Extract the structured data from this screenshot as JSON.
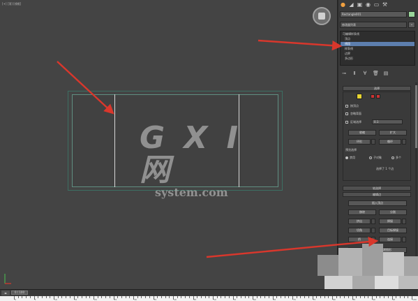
{
  "viewport": {
    "label": "[+] [顶] [线框]",
    "watermark_brand": "G X I 网",
    "watermark_domain": "system.com"
  },
  "panel": {
    "tabs": [
      "create-icon",
      "modify-icon",
      "hierarchy-icon",
      "motion-icon",
      "display-icon",
      "utilities-icon"
    ],
    "object_name": "Rectangle001",
    "object_color": "#9ad59a",
    "modifier_list": "修改器列表",
    "stack": {
      "root": "可编辑样条线",
      "items": [
        "顶点",
        "线段",
        "样条线",
        "边界",
        "多边形"
      ],
      "selected_index": 1
    },
    "selection_rollout": {
      "title": "选择",
      "by_vertex": "按顶点",
      "ignore_backfacing": "忽略背面",
      "area_selection": "区域选择",
      "area_value": "0.1",
      "shrink": "收缩",
      "grow": "扩大",
      "ring": "环形",
      "loop": "循环",
      "preview_selection": "预览选择",
      "disabled": "禁用",
      "subobject": "子对象",
      "multi": "多个",
      "selected_count": "选择了 1 个边"
    },
    "soft_selection_title": "软选择",
    "edit_edges_title": "编辑边",
    "edit_buttons": {
      "insert_vertex": "插入顶点",
      "remove": "移除",
      "split": "分割",
      "extrude": "挤出",
      "weld": "焊接",
      "chamfer": "切角",
      "target_weld": "目标焊接",
      "bridge": "桥",
      "connect": "连接",
      "create_shape": "利用所选内容创建图形"
    }
  },
  "timeline": {
    "frame_label": "0 / 100",
    "ticks": [
      "0",
      "5",
      "10",
      "15",
      "20",
      "25",
      "30",
      "35",
      "40",
      "45",
      "50",
      "55",
      "60",
      "65",
      "70",
      "75",
      "80",
      "85",
      "90",
      "95",
      "100"
    ]
  },
  "colors": {
    "selection_highlight": "#5d7fae",
    "arrow": "#d9372c",
    "active_tab": "#f0a040",
    "spline_outer": "#3c6f63",
    "spline_inner": "#5f8f82"
  }
}
